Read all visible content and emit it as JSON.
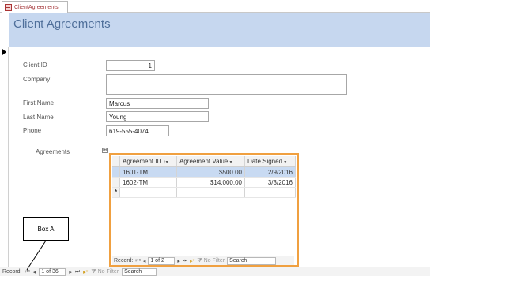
{
  "tab": {
    "label": "ClientAgreements",
    "icon": "form-icon"
  },
  "header": {
    "title": "Client Agreements"
  },
  "fields": {
    "client_id": {
      "label": "Client ID",
      "value": "1"
    },
    "company": {
      "label": "Company",
      "value": ""
    },
    "first_name": {
      "label": "First Name",
      "value": "Marcus"
    },
    "last_name": {
      "label": "Last Name",
      "value": "Young"
    },
    "phone": {
      "label": "Phone",
      "value": "619-555-4074"
    }
  },
  "agreements": {
    "label": "Agreements",
    "expander": "⊞",
    "columns": [
      "Agreement ID",
      "Agreement Value",
      "Date Signed"
    ],
    "rows": [
      [
        "1601-TM",
        "$500.00",
        "2/9/2016"
      ],
      [
        "1602-TM",
        "$14,000.00",
        "3/3/2016"
      ]
    ],
    "new_row_marker": "*",
    "nav": {
      "record_label": "Record:",
      "position": "1 of 2",
      "filter_label": "No Filter",
      "search_label": "Search"
    }
  },
  "main_nav": {
    "record_label": "Record:",
    "position": "1 of 36",
    "filter_label": "No Filter",
    "search_label": "Search"
  },
  "callout": {
    "label": "Box A"
  },
  "colors": {
    "header_bg": "#c6d7ef",
    "highlight": "#f0a040",
    "selected_row": "#c8daf2"
  }
}
